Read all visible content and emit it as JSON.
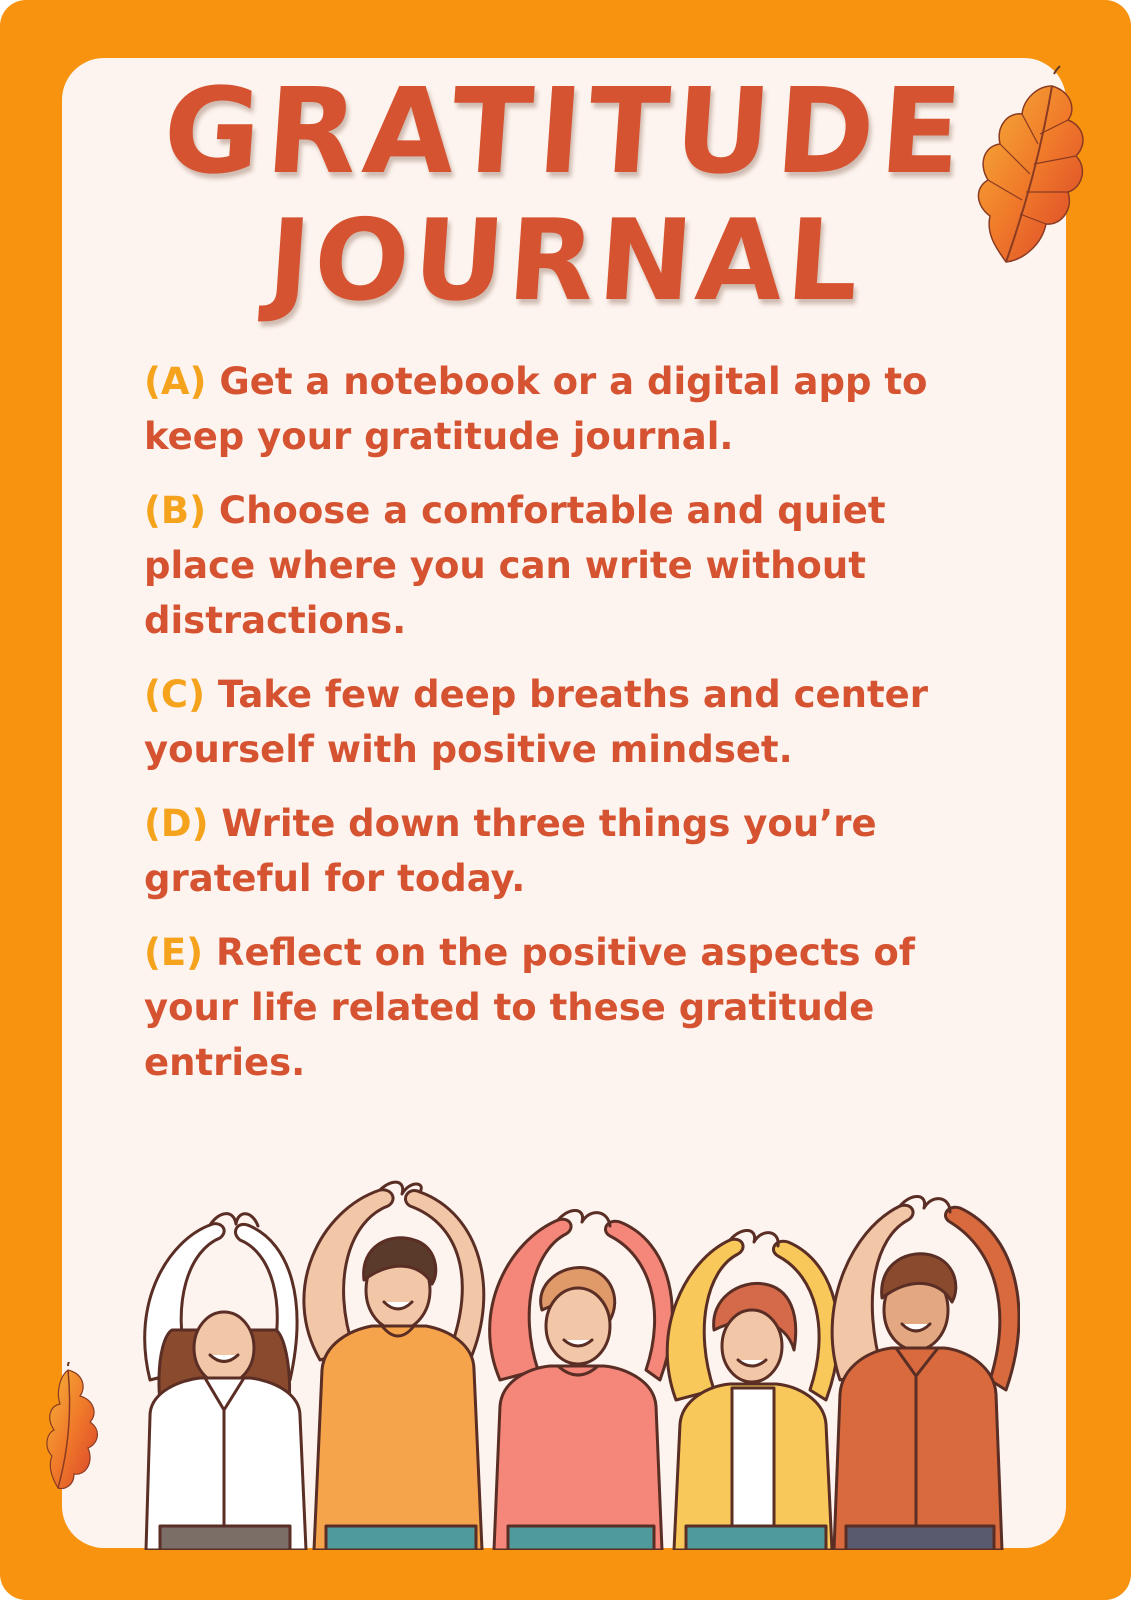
{
  "title": {
    "line1": "GRATITUDE",
    "line2": "JOURNAL"
  },
  "steps": [
    {
      "letter": "(A)",
      "text": " Get a notebook or a digital app to keep your gratitude journal."
    },
    {
      "letter": "(B)",
      "text": " Choose a comfortable and quiet place where you can write without distractions."
    },
    {
      "letter": "(C)",
      "text": " Take few deep breaths and center yourself with positive mindset."
    },
    {
      "letter": "(D)",
      "text": " Write down three things you’re grateful for today."
    },
    {
      "letter": "(E)",
      "text": " Reflect on the positive aspects of your life related to these gratitude entries."
    }
  ],
  "colors": {
    "frame": "#F7930F",
    "card": "#FDF4EF",
    "text": "#D55331",
    "step_letter": "#F5A31D"
  },
  "illustrations": {
    "leaf": "autumn-oak-leaf",
    "people": "five-people-making-heart-hands"
  }
}
